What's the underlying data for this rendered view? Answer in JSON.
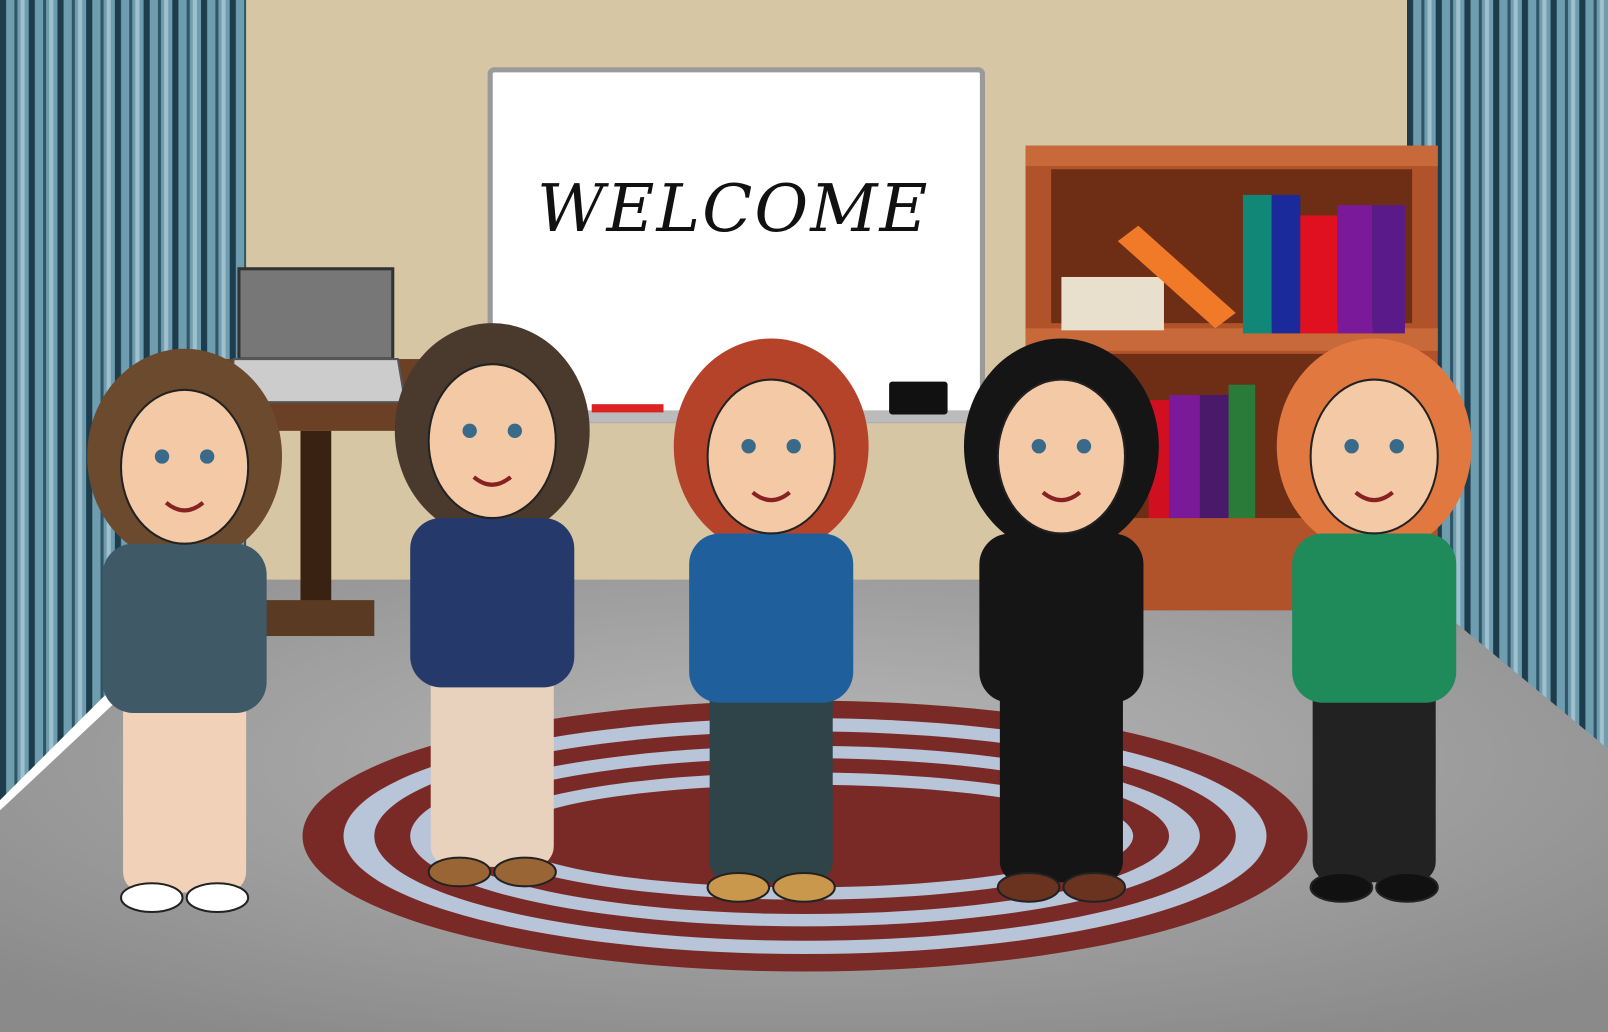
{
  "whiteboard": {
    "text": "WELCOME"
  },
  "colors": {
    "wall": "#d8c9a8",
    "curtain": "#5f8ea0",
    "floor": "#a9a9a9",
    "rug_red": "#7a2a26",
    "rug_blue": "#b8c4d8",
    "shelf": "#b0522a"
  },
  "people": [
    {
      "name": "curly-hair-woman",
      "top": "#3f5a66",
      "hair": "#6b4a2e",
      "legs": "#f1d2b8",
      "shoes": "#ffffff"
    },
    {
      "name": "bearded-man",
      "top": "#253a6b",
      "hair": "#4a3a2e",
      "legs": "#e8d2bd",
      "shoes": "#9a6534"
    },
    {
      "name": "redhead-woman",
      "top": "#1f5f9c",
      "hair": "#b5432a",
      "legs": "#2e4448",
      "shoes": "#c9984c"
    },
    {
      "name": "black-hair-woman",
      "top": "#151515",
      "hair": "#151515",
      "legs": "#151515",
      "shoes": "#6a3320"
    },
    {
      "name": "waving-woman",
      "top": "#1f8a5a",
      "hair": "#e0783f",
      "legs": "#222222",
      "shoes": "#111111"
    }
  ]
}
